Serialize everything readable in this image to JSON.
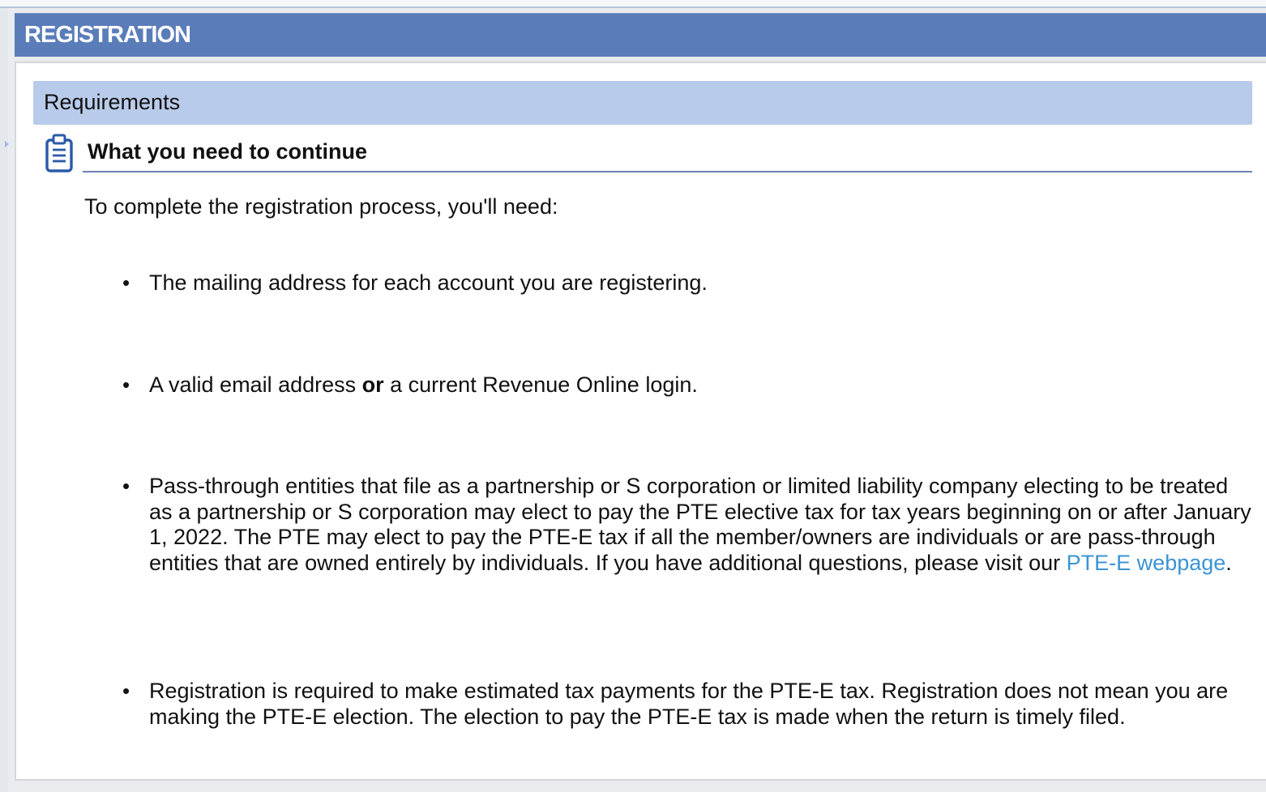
{
  "panel": {
    "title": "REGISTRATION"
  },
  "section": {
    "title": "Requirements",
    "icon": "clipboard-icon",
    "subheading": "What you need to continue",
    "intro": "To complete the registration process, you'll need:"
  },
  "requirements": {
    "item1": {
      "text": "The mailing address for each account you are registering."
    },
    "item2": {
      "before": "A valid email address ",
      "emphasis": "or",
      "after": " a current Revenue Online login."
    },
    "item3": {
      "text": "Pass-through entities that file as a partnership or S corporation or limited liability company electing to be treated as a partnership or S corporation may elect to pay the PTE elective tax for tax years beginning on or after January 1, 2022. The PTE may elect to pay the PTE-E tax if all the member/owners are individuals or are pass-through entities that are owned entirely by individuals. If you have additional questions, please visit our ",
      "link_label": "PTE-E webpage",
      "after": "."
    },
    "item4": {
      "text": "Registration is required to make estimated tax payments for the PTE-E tax. Registration does not mean you are making the PTE-E election. The election to pay the PTE-E tax is made when the return is timely filed."
    }
  },
  "colors": {
    "header_bg": "#5a7dba",
    "section_band": "#b9cbea",
    "link": "#3b94d3",
    "rule": "#6f7fb5"
  }
}
